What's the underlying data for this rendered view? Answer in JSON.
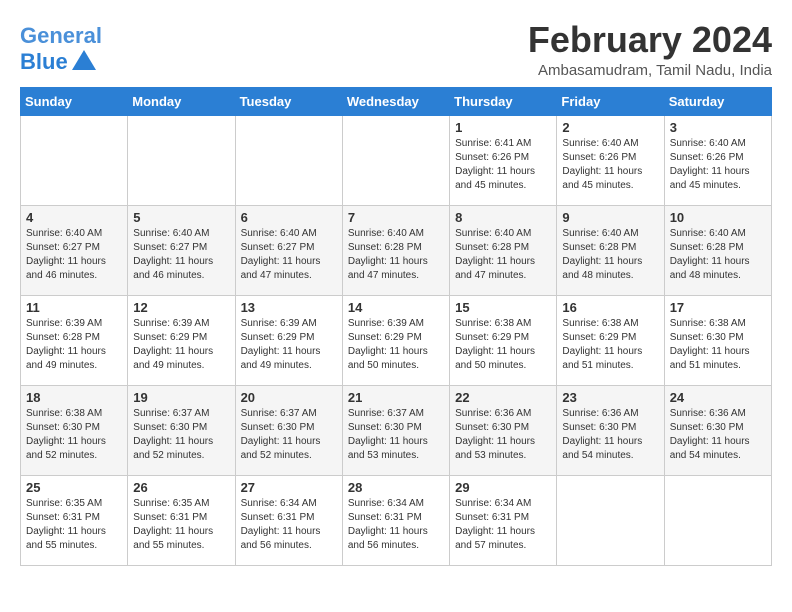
{
  "header": {
    "logo_line1": "General",
    "logo_line2": "Blue",
    "month_year": "February 2024",
    "location": "Ambasamudram, Tamil Nadu, India"
  },
  "weekdays": [
    "Sunday",
    "Monday",
    "Tuesday",
    "Wednesday",
    "Thursday",
    "Friday",
    "Saturday"
  ],
  "weeks": [
    [
      {
        "day": "",
        "info": ""
      },
      {
        "day": "",
        "info": ""
      },
      {
        "day": "",
        "info": ""
      },
      {
        "day": "",
        "info": ""
      },
      {
        "day": "1",
        "info": "Sunrise: 6:41 AM\nSunset: 6:26 PM\nDaylight: 11 hours\nand 45 minutes."
      },
      {
        "day": "2",
        "info": "Sunrise: 6:40 AM\nSunset: 6:26 PM\nDaylight: 11 hours\nand 45 minutes."
      },
      {
        "day": "3",
        "info": "Sunrise: 6:40 AM\nSunset: 6:26 PM\nDaylight: 11 hours\nand 45 minutes."
      }
    ],
    [
      {
        "day": "4",
        "info": "Sunrise: 6:40 AM\nSunset: 6:27 PM\nDaylight: 11 hours\nand 46 minutes."
      },
      {
        "day": "5",
        "info": "Sunrise: 6:40 AM\nSunset: 6:27 PM\nDaylight: 11 hours\nand 46 minutes."
      },
      {
        "day": "6",
        "info": "Sunrise: 6:40 AM\nSunset: 6:27 PM\nDaylight: 11 hours\nand 47 minutes."
      },
      {
        "day": "7",
        "info": "Sunrise: 6:40 AM\nSunset: 6:28 PM\nDaylight: 11 hours\nand 47 minutes."
      },
      {
        "day": "8",
        "info": "Sunrise: 6:40 AM\nSunset: 6:28 PM\nDaylight: 11 hours\nand 47 minutes."
      },
      {
        "day": "9",
        "info": "Sunrise: 6:40 AM\nSunset: 6:28 PM\nDaylight: 11 hours\nand 48 minutes."
      },
      {
        "day": "10",
        "info": "Sunrise: 6:40 AM\nSunset: 6:28 PM\nDaylight: 11 hours\nand 48 minutes."
      }
    ],
    [
      {
        "day": "11",
        "info": "Sunrise: 6:39 AM\nSunset: 6:28 PM\nDaylight: 11 hours\nand 49 minutes."
      },
      {
        "day": "12",
        "info": "Sunrise: 6:39 AM\nSunset: 6:29 PM\nDaylight: 11 hours\nand 49 minutes."
      },
      {
        "day": "13",
        "info": "Sunrise: 6:39 AM\nSunset: 6:29 PM\nDaylight: 11 hours\nand 49 minutes."
      },
      {
        "day": "14",
        "info": "Sunrise: 6:39 AM\nSunset: 6:29 PM\nDaylight: 11 hours\nand 50 minutes."
      },
      {
        "day": "15",
        "info": "Sunrise: 6:38 AM\nSunset: 6:29 PM\nDaylight: 11 hours\nand 50 minutes."
      },
      {
        "day": "16",
        "info": "Sunrise: 6:38 AM\nSunset: 6:29 PM\nDaylight: 11 hours\nand 51 minutes."
      },
      {
        "day": "17",
        "info": "Sunrise: 6:38 AM\nSunset: 6:30 PM\nDaylight: 11 hours\nand 51 minutes."
      }
    ],
    [
      {
        "day": "18",
        "info": "Sunrise: 6:38 AM\nSunset: 6:30 PM\nDaylight: 11 hours\nand 52 minutes."
      },
      {
        "day": "19",
        "info": "Sunrise: 6:37 AM\nSunset: 6:30 PM\nDaylight: 11 hours\nand 52 minutes."
      },
      {
        "day": "20",
        "info": "Sunrise: 6:37 AM\nSunset: 6:30 PM\nDaylight: 11 hours\nand 52 minutes."
      },
      {
        "day": "21",
        "info": "Sunrise: 6:37 AM\nSunset: 6:30 PM\nDaylight: 11 hours\nand 53 minutes."
      },
      {
        "day": "22",
        "info": "Sunrise: 6:36 AM\nSunset: 6:30 PM\nDaylight: 11 hours\nand 53 minutes."
      },
      {
        "day": "23",
        "info": "Sunrise: 6:36 AM\nSunset: 6:30 PM\nDaylight: 11 hours\nand 54 minutes."
      },
      {
        "day": "24",
        "info": "Sunrise: 6:36 AM\nSunset: 6:30 PM\nDaylight: 11 hours\nand 54 minutes."
      }
    ],
    [
      {
        "day": "25",
        "info": "Sunrise: 6:35 AM\nSunset: 6:31 PM\nDaylight: 11 hours\nand 55 minutes."
      },
      {
        "day": "26",
        "info": "Sunrise: 6:35 AM\nSunset: 6:31 PM\nDaylight: 11 hours\nand 55 minutes."
      },
      {
        "day": "27",
        "info": "Sunrise: 6:34 AM\nSunset: 6:31 PM\nDaylight: 11 hours\nand 56 minutes."
      },
      {
        "day": "28",
        "info": "Sunrise: 6:34 AM\nSunset: 6:31 PM\nDaylight: 11 hours\nand 56 minutes."
      },
      {
        "day": "29",
        "info": "Sunrise: 6:34 AM\nSunset: 6:31 PM\nDaylight: 11 hours\nand 57 minutes."
      },
      {
        "day": "",
        "info": ""
      },
      {
        "day": "",
        "info": ""
      }
    ]
  ]
}
